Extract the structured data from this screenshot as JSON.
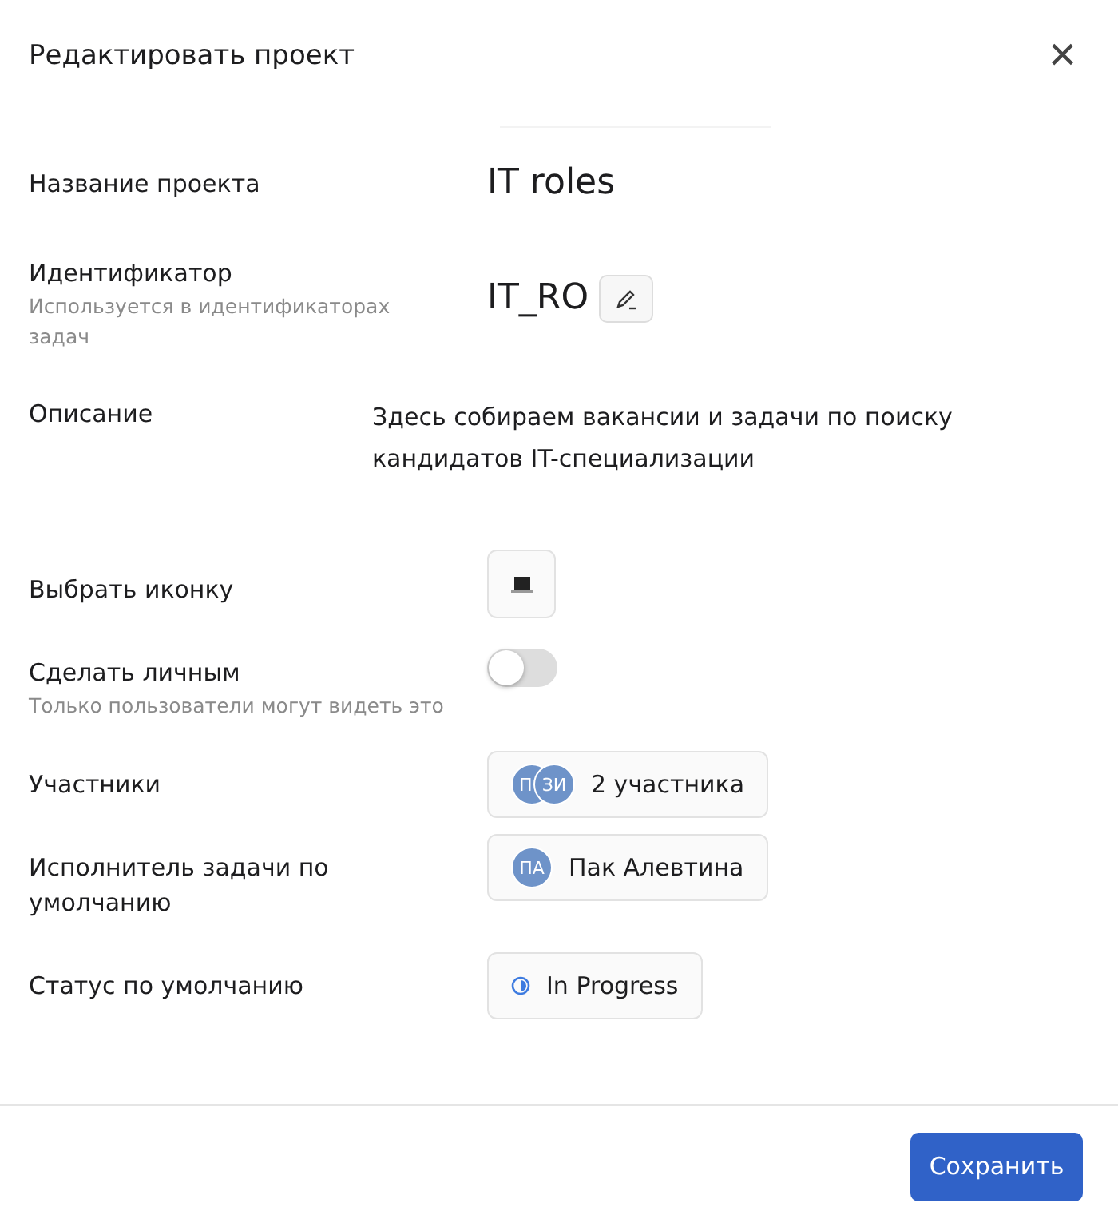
{
  "dialog": {
    "title": "Редактировать проект",
    "close": "×"
  },
  "fields": [
    {
      "kind": "title",
      "label": "Название проекта",
      "value": "IT roles"
    },
    {
      "kind": "identifier",
      "label": "Идентификатор",
      "hint": "Используется в идентификаторах задач",
      "value": "IT_RO"
    },
    {
      "kind": "description",
      "label": "Описание",
      "value": "Здесь собираем вакансии и задачи по поиску кандидатов IT-специализации"
    },
    {
      "kind": "icon",
      "label": "Выбрать иконку"
    },
    {
      "kind": "toggle",
      "label": "Сделать личным",
      "hint": "Только пользователи могут видеть это",
      "on": false
    },
    {
      "kind": "members",
      "label": "Участники",
      "avatars": [
        "П",
        "ЗИ"
      ],
      "value": "2 участника"
    },
    {
      "kind": "assignee",
      "label": "Исполнитель задачи по умолчанию",
      "avatars": [
        "ПА"
      ],
      "value": "Пак Алевтина"
    },
    {
      "kind": "status",
      "label": "Статус по умолчанию",
      "value": "In Progress"
    }
  ],
  "save": "Сохранить"
}
